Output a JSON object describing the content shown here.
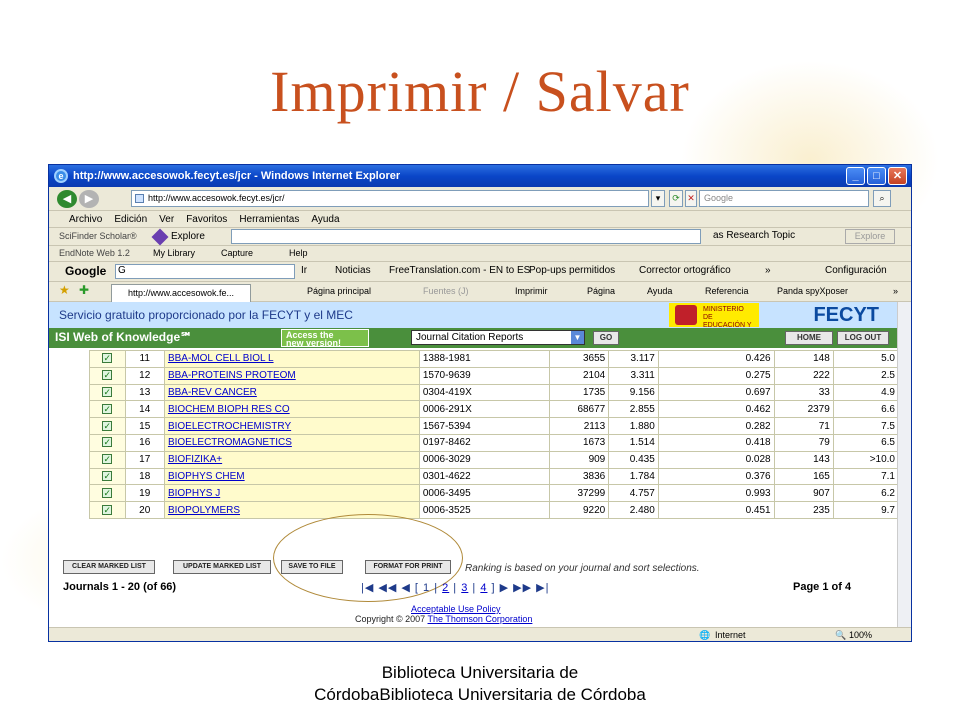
{
  "slide": {
    "title": "Imprimir / Salvar",
    "footer_line1": "Biblioteca Universitaria de",
    "footer_line2": "CórdobaBiblioteca Universitaria de Córdoba"
  },
  "browser": {
    "window_title": "http://www.accesowok.fecyt.es/jcr - Windows Internet Explorer",
    "address": "http://www.accesowok.fecyt.es/jcr/",
    "search_placeholder": "Google",
    "menu": [
      "Archivo",
      "Edición",
      "Ver",
      "Favoritos",
      "Herramientas",
      "Ayuda"
    ],
    "scifinder": {
      "label": "SciFinder Scholar®",
      "explore": "Explore",
      "topic": "as Research Topic",
      "explore2": "Explore"
    },
    "endnote": {
      "label": "EndNote Web 1.2",
      "library": "My Library",
      "capture": "Capture",
      "help": "Help"
    },
    "google_bar": {
      "logo": "Google",
      "g": "G",
      "ir": "Ir",
      "noticias": "Noticias",
      "translation": "FreeTranslation.com - EN to ES",
      "popups": "Pop-ups permitidos",
      "corrector": "Corrector ortográfico",
      "more": "»",
      "config": "Configuración"
    },
    "tab_title": "http://www.accesowok.fe...",
    "command_bar": {
      "home": "Página principal",
      "feeds": "Fuentes (J)",
      "print": "Imprimir",
      "page": "Página",
      "help": "Ayuda",
      "ref": "Referencia",
      "panda": "Panda spyXposer",
      "more": "»"
    },
    "status": {
      "zone": "Internet",
      "zoom": "100%"
    }
  },
  "page": {
    "banner": "Servicio gratuito proporcionado por la FECYT y el MEC",
    "ministry": "MINISTERIO DE EDUCACIÓN Y CIENCIA",
    "fecyt": "FECYT",
    "isi_title": "ISI Web of Knowledge℠",
    "access_badge_1": "Access the",
    "access_badge_2": "new version!",
    "db_select": "Journal Citation Reports",
    "go": "GO",
    "home": "HOME",
    "logout": "LOG OUT",
    "rows": [
      {
        "n": "11",
        "title": "BBA-MOL CELL BIOL L",
        "issn": "1388-1981",
        "cites": "3655",
        "if": "3.117",
        "imm": "0.426",
        "art": "148",
        "half": "5.0"
      },
      {
        "n": "12",
        "title": "BBA-PROTEINS PROTEOM",
        "issn": "1570-9639",
        "cites": "2104",
        "if": "3.311",
        "imm": "0.275",
        "art": "222",
        "half": "2.5"
      },
      {
        "n": "13",
        "title": "BBA-REV CANCER",
        "issn": "0304-419X",
        "cites": "1735",
        "if": "9.156",
        "imm": "0.697",
        "art": "33",
        "half": "4.9"
      },
      {
        "n": "14",
        "title": "BIOCHEM BIOPH RES CO",
        "issn": "0006-291X",
        "cites": "68677",
        "if": "2.855",
        "imm": "0.462",
        "art": "2379",
        "half": "6.6"
      },
      {
        "n": "15",
        "title": "BIOELECTROCHEMISTRY",
        "issn": "1567-5394",
        "cites": "2113",
        "if": "1.880",
        "imm": "0.282",
        "art": "71",
        "half": "7.5"
      },
      {
        "n": "16",
        "title": "BIOELECTROMAGNETICS",
        "issn": "0197-8462",
        "cites": "1673",
        "if": "1.514",
        "imm": "0.418",
        "art": "79",
        "half": "6.5"
      },
      {
        "n": "17",
        "title": "BIOFIZIKA+",
        "issn": "0006-3029",
        "cites": "909",
        "if": "0.435",
        "imm": "0.028",
        "art": "143",
        "half": ">10.0"
      },
      {
        "n": "18",
        "title": "BIOPHYS CHEM",
        "issn": "0301-4622",
        "cites": "3836",
        "if": "1.784",
        "imm": "0.376",
        "art": "165",
        "half": "7.1"
      },
      {
        "n": "19",
        "title": "BIOPHYS J",
        "issn": "0006-3495",
        "cites": "37299",
        "if": "4.757",
        "imm": "0.993",
        "art": "907",
        "half": "6.2"
      },
      {
        "n": "20",
        "title": "BIOPOLYMERS",
        "issn": "0006-3525",
        "cites": "9220",
        "if": "2.480",
        "imm": "0.451",
        "art": "235",
        "half": "9.7"
      }
    ],
    "buttons": {
      "clear": "CLEAR MARKED LIST",
      "update": "UPDATE MARKED LIST",
      "save": "SAVE TO FILE",
      "print": "FORMAT FOR PRINT"
    },
    "ranking_note": "Ranking is based on your journal and sort selections.",
    "journals_count": "Journals 1 - 20 (of 66)",
    "pager_pages": [
      "1",
      "2",
      "3",
      "4"
    ],
    "page_of": "Page 1 of 4",
    "use_policy": "Acceptable Use Policy",
    "copyright_prefix": "Copyright © 2007",
    "copyright_link": "The Thomson Corporation"
  }
}
